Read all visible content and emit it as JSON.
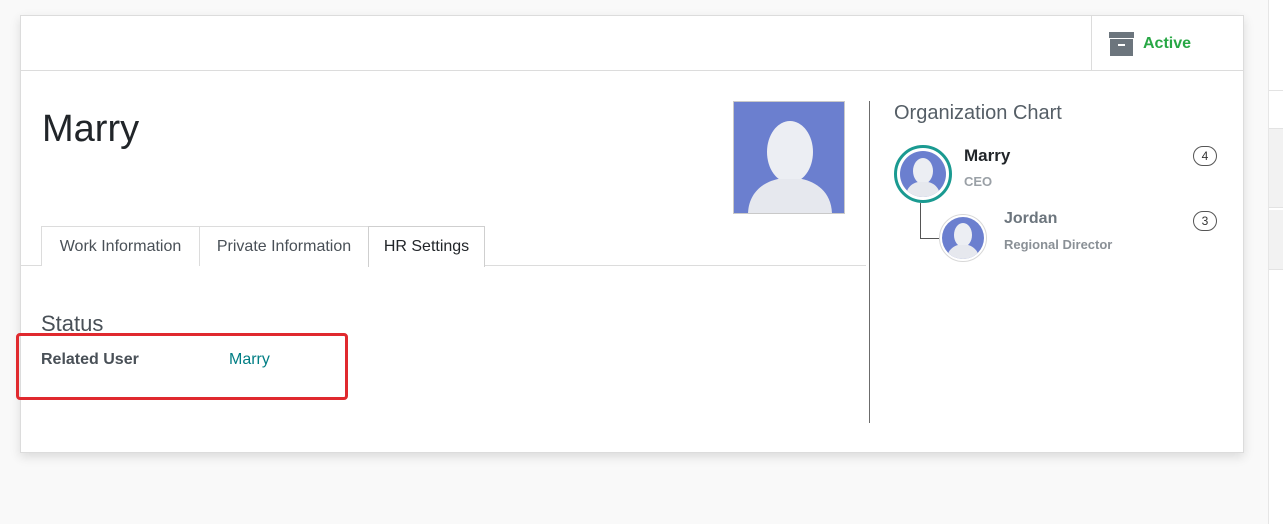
{
  "header": {
    "status_button": {
      "label": "Active",
      "icon": "archive-icon",
      "color": "#28a745"
    }
  },
  "employee": {
    "name": "Marry",
    "avatar": "person-silhouette-icon"
  },
  "tabs": [
    {
      "label": "Work Information",
      "active": false
    },
    {
      "label": "Private Information",
      "active": false
    },
    {
      "label": "HR Settings",
      "active": true
    }
  ],
  "hr_settings": {
    "section_title": "Status",
    "related_user_label": "Related User",
    "related_user_value": "Marry"
  },
  "org_chart": {
    "title": "Organization Chart",
    "nodes": [
      {
        "name": "Marry",
        "job": "CEO",
        "count": "4"
      },
      {
        "name": "Jordan",
        "job": "Regional Director",
        "count": "3"
      }
    ]
  },
  "colors": {
    "accent_teal": "#017e84",
    "highlight_red": "#e0292e",
    "avatar_bg": "#6b7fcf"
  }
}
